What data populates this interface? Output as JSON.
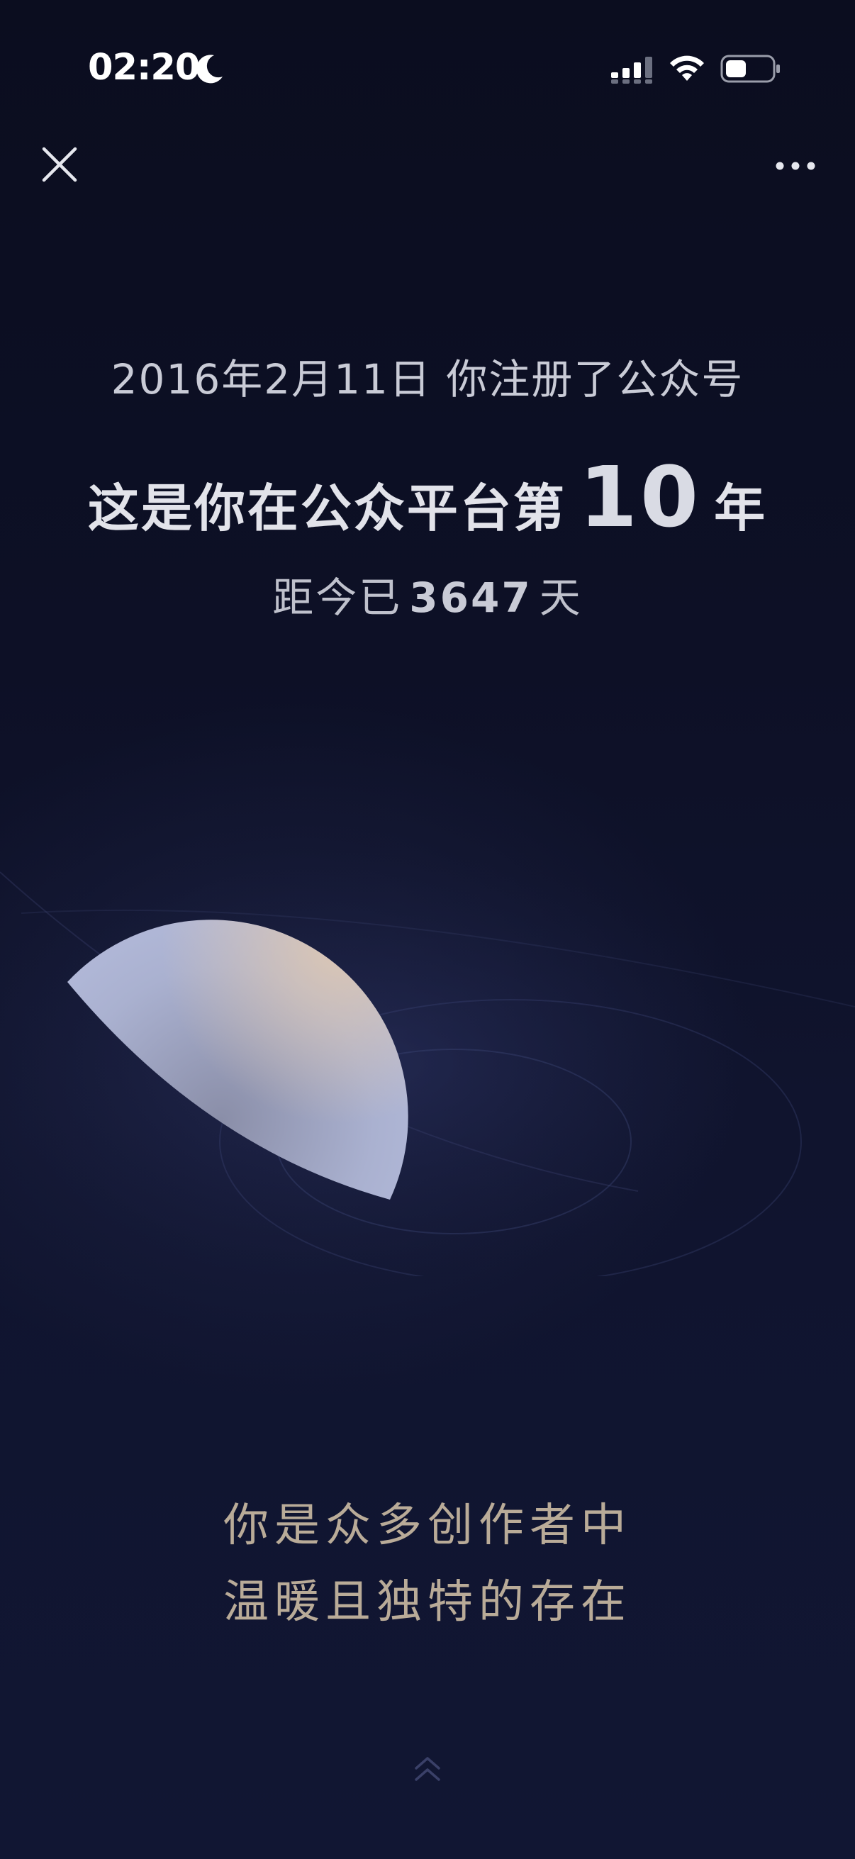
{
  "status_bar": {
    "time": "02:20",
    "icons": [
      "moon-icon",
      "signal-icon",
      "wifi-icon",
      "battery-icon"
    ]
  },
  "nav": {
    "close_icon": "close-icon",
    "more_icon": "more-icon"
  },
  "headline": {
    "registration_text": "2016年2月11日  你注册了公众号",
    "years_prefix": "这是你在公众平台第",
    "years_number": "10",
    "years_suffix": "年",
    "days_prefix": "距今已",
    "days_number": "3647",
    "days_suffix": "天"
  },
  "tagline": {
    "line1": "你是众多创作者中",
    "line2": "温暖且独特的存在"
  },
  "colors": {
    "background_top": "#0b0d1f",
    "background_bottom": "#111633",
    "tagline_gold": "#b9ab98",
    "text_light": "#e2e3ea"
  }
}
